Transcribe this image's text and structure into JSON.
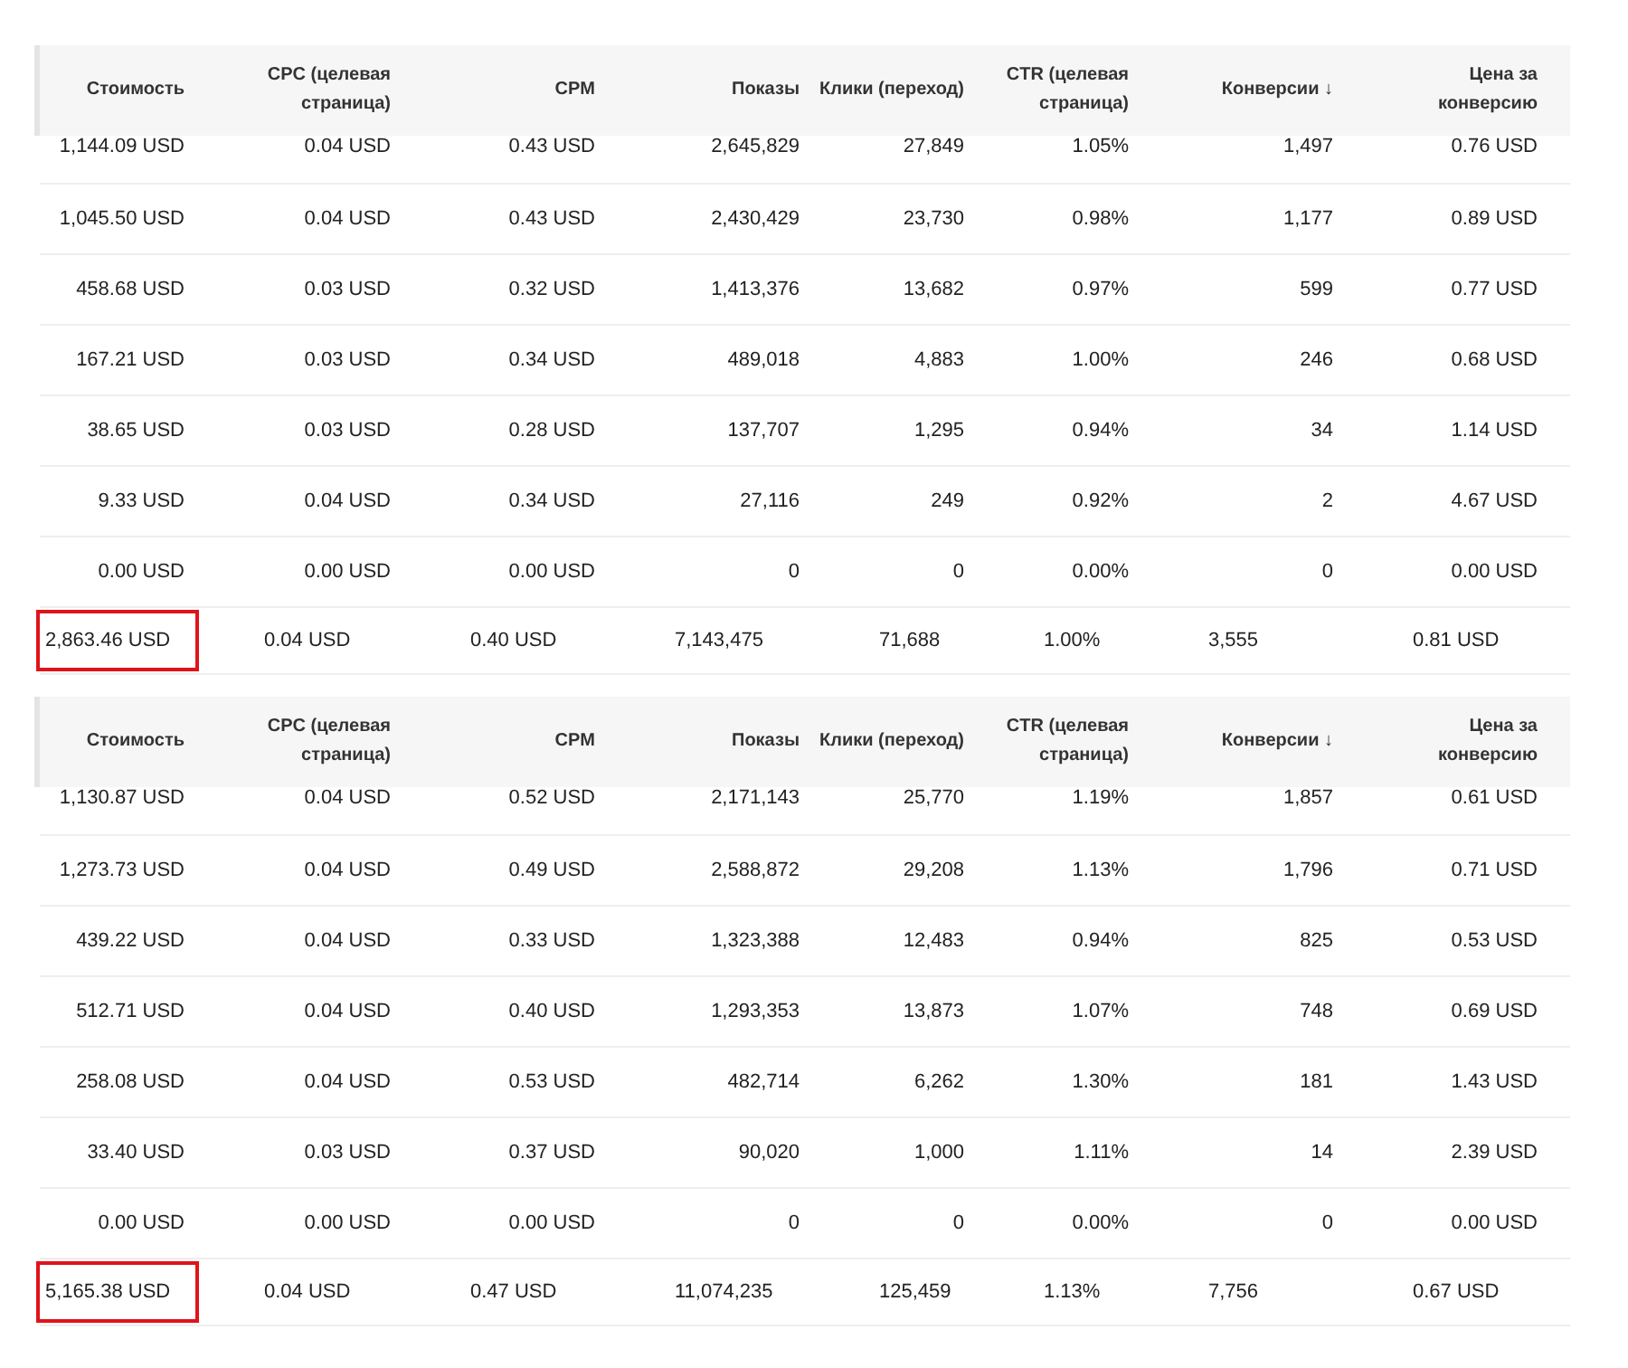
{
  "tables": [
    {
      "columns": [
        "Стоимость",
        "CPC (целевая страница)",
        "CPM",
        "Показы",
        "Клики (переход)",
        "CTR (целевая страница)",
        "Конверсии ↓",
        "Цена за конверсию"
      ],
      "rows": [
        [
          "1,144.09 USD",
          "0.04 USD",
          "0.43 USD",
          "2,645,829",
          "27,849",
          "1.05%",
          "1,497",
          "0.76 USD"
        ],
        [
          "1,045.50 USD",
          "0.04 USD",
          "0.43 USD",
          "2,430,429",
          "23,730",
          "0.98%",
          "1,177",
          "0.89 USD"
        ],
        [
          "458.68 USD",
          "0.03 USD",
          "0.32 USD",
          "1,413,376",
          "13,682",
          "0.97%",
          "599",
          "0.77 USD"
        ],
        [
          "167.21 USD",
          "0.03 USD",
          "0.34 USD",
          "489,018",
          "4,883",
          "1.00%",
          "246",
          "0.68 USD"
        ],
        [
          "38.65 USD",
          "0.03 USD",
          "0.28 USD",
          "137,707",
          "1,295",
          "0.94%",
          "34",
          "1.14 USD"
        ],
        [
          "9.33 USD",
          "0.04 USD",
          "0.34 USD",
          "27,116",
          "249",
          "0.92%",
          "2",
          "4.67 USD"
        ],
        [
          "0.00 USD",
          "0.00 USD",
          "0.00 USD",
          "0",
          "0",
          "0.00%",
          "0",
          "0.00 USD"
        ]
      ],
      "totals": [
        {
          "text": "2,863.46 USD",
          "highlighted": true
        },
        {
          "text": "0.04 USD",
          "highlighted": false
        },
        {
          "text": "0.40 USD",
          "highlighted": false
        },
        {
          "text": "7,143,475",
          "highlighted": false
        },
        {
          "text": "71,688",
          "highlighted": false
        },
        {
          "text": "1.00%",
          "highlighted": false
        },
        {
          "text": "3,555",
          "highlighted": false
        },
        {
          "text": "0.81 USD",
          "highlighted": false
        }
      ]
    },
    {
      "columns": [
        "Стоимость",
        "CPC (целевая страница)",
        "CPM",
        "Показы",
        "Клики (переход)",
        "CTR (целевая страница)",
        "Конверсии ↓",
        "Цена за конверсию"
      ],
      "rows": [
        [
          "1,130.87 USD",
          "0.04 USD",
          "0.52 USD",
          "2,171,143",
          "25,770",
          "1.19%",
          "1,857",
          "0.61 USD"
        ],
        [
          "1,273.73 USD",
          "0.04 USD",
          "0.49 USD",
          "2,588,872",
          "29,208",
          "1.13%",
          "1,796",
          "0.71 USD"
        ],
        [
          "439.22 USD",
          "0.04 USD",
          "0.33 USD",
          "1,323,388",
          "12,483",
          "0.94%",
          "825",
          "0.53 USD"
        ],
        [
          "512.71 USD",
          "0.04 USD",
          "0.40 USD",
          "1,293,353",
          "13,873",
          "1.07%",
          "748",
          "0.69 USD"
        ],
        [
          "258.08 USD",
          "0.04 USD",
          "0.53 USD",
          "482,714",
          "6,262",
          "1.30%",
          "181",
          "1.43 USD"
        ],
        [
          "33.40 USD",
          "0.03 USD",
          "0.37 USD",
          "90,020",
          "1,000",
          "1.11%",
          "14",
          "2.39 USD"
        ],
        [
          "0.00 USD",
          "0.00 USD",
          "0.00 USD",
          "0",
          "0",
          "0.00%",
          "0",
          "0.00 USD"
        ]
      ],
      "totals": [
        {
          "text": "5,165.38 USD",
          "highlighted": true
        },
        {
          "text": "0.04 USD",
          "highlighted": false
        },
        {
          "text": "0.47 USD",
          "highlighted": false
        },
        {
          "text": "11,074,235",
          "highlighted": false
        },
        {
          "text": "125,459",
          "highlighted": false
        },
        {
          "text": "1.13%",
          "highlighted": false
        },
        {
          "text": "7,756",
          "highlighted": false
        },
        {
          "text": "0.67 USD",
          "highlighted": false
        }
      ]
    }
  ]
}
